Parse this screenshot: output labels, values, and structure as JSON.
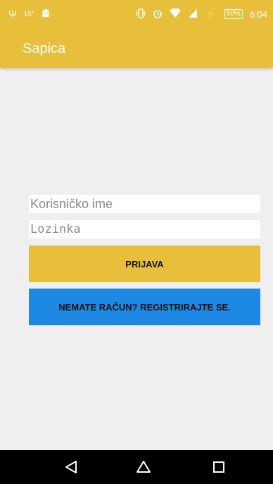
{
  "status_bar": {
    "left_icons": [
      "usb-icon",
      "temperature-icon",
      "android-icon"
    ],
    "temperature": "15°",
    "right_icons": [
      "vibrate-icon",
      "alarm-icon",
      "wifi-icon",
      "signal-icon",
      "charging-icon"
    ],
    "battery": "50%",
    "time": "6:04"
  },
  "app_bar": {
    "title": "Sapica"
  },
  "form": {
    "username_placeholder": "Korisničko ime",
    "password_placeholder": "Lozinka",
    "login_label": "PRIJAVA",
    "register_label": "NEMATE RAČUN? REGISTRIRAJTE SE."
  },
  "nav_bar": {
    "icons": [
      "back-icon",
      "home-icon",
      "recent-apps-icon"
    ]
  },
  "colors": {
    "accent": "#e8bf3a",
    "register_button": "#1e88e5",
    "background": "#efefef",
    "nav_bar": "#000000"
  }
}
